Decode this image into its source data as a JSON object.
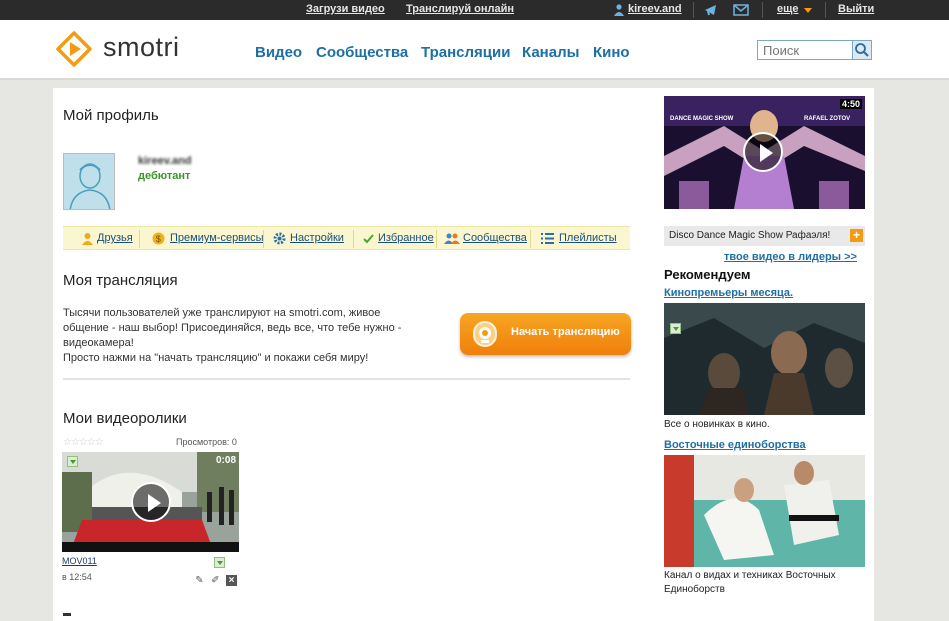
{
  "topbar": {
    "upload": "Загрузи видео",
    "broadcast": "Транслируй онлайн",
    "username": "kireev.and",
    "more": "еще",
    "logout": "Выйти"
  },
  "header": {
    "logo_text": "smotri",
    "nav": [
      "Видео",
      "Сообщества",
      "Трансляции",
      "Каналы",
      "Кино"
    ],
    "search_placeholder": "Поиск"
  },
  "profile": {
    "title": "Мой профиль",
    "username": "kireev.and",
    "rank": "дебютант",
    "tabs": [
      "Друзья",
      "Премиум-сервисы",
      "Настройки",
      "Избранное",
      "Сообщества",
      "Плейлисты"
    ]
  },
  "stream": {
    "title": "Моя трансляция",
    "text": "Тысячи пользователей уже транслируют на smotri.com, живое общение - наш выбор! Присоединяйся, ведь все, что тебе нужно - видеокамера!",
    "text2": "Просто нажми на \"начать трансляцию\" и покажи себя миру!",
    "button": "Начать трансляцию"
  },
  "videos": {
    "title": "Мои видеоролики",
    "stars": "☆☆☆☆☆",
    "views": "Просмотров: 0",
    "items": [
      {
        "duration": "0:08",
        "name": "MOV011",
        "time": "в 12:54"
      }
    ]
  },
  "sidebar": {
    "featured": {
      "duration": "4:50",
      "overlay_left": "DANCE MAGIC SHOW",
      "overlay_right": "RAFAEL ZOTOV",
      "caption": "Disco Dance Magic Show Рафаэля!"
    },
    "leader_link": "твое видео в лидеры >>",
    "recommend_title": "Рекомендуем",
    "items": [
      {
        "link": "Кинопремьеры месяца.",
        "caption": "Все о новинках в кино."
      },
      {
        "link": "Восточные единоборства",
        "caption": "Канал о видах и техниках Восточных Единоборств"
      }
    ]
  },
  "colors": {
    "link": "#1e6fa3",
    "accent": "#f39c12",
    "rank_green": "#39952a",
    "topbar_bg": "#2b2b2b"
  }
}
